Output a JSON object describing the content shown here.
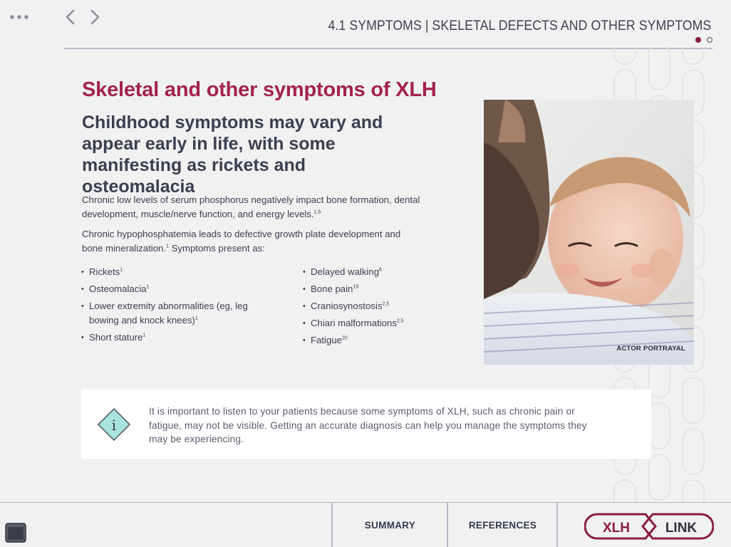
{
  "header": {
    "section_title": "4.1 SYMPTOMS | SKELETAL DEFECTS AND OTHER SYMPTOMS",
    "page_indicator": {
      "current": 1,
      "total": 2
    },
    "icons": {
      "more": "more-dots-icon",
      "back": "chevron-left-icon",
      "forward": "chevron-right-icon"
    }
  },
  "main": {
    "heading": "Skeletal and other symptoms of XLH",
    "subheading": "Childhood symptoms may vary and appear early in life, with some manifesting as rickets and osteomalacia",
    "paragraph1": {
      "text": "Chronic low levels of serum phosphorus negatively impact bone formation, dental development, muscle/nerve function, and energy levels.",
      "ref": "1,5"
    },
    "paragraph2": {
      "text": "Chronic hypophosphatemia leads to defective growth plate development and bone mineralization.",
      "ref": "1",
      "tail": " Symptoms present as:"
    },
    "symptoms_left": [
      {
        "label": "Rickets",
        "ref": "1"
      },
      {
        "label": "Osteomalacia",
        "ref": "1"
      },
      {
        "label": "Lower extremity abnormalities (eg, leg bowing and knock knees)",
        "ref": "1"
      },
      {
        "label": "Short stature",
        "ref": "1"
      }
    ],
    "symptoms_right": [
      {
        "label": "Delayed walking",
        "ref": "6"
      },
      {
        "label": "Bone pain",
        "ref": "19"
      },
      {
        "label": "Craniosynostosis",
        "ref": "2,5"
      },
      {
        "label": "Chiari malformations",
        "ref": "2,5"
      },
      {
        "label": "Fatigue",
        "ref": "20"
      }
    ],
    "photo_caption": "ACTOR PORTRAYAL"
  },
  "info_box": {
    "icon": "info-diamond-icon",
    "icon_glyph": "i",
    "text": "It is important to listen to your patients because some symptoms of XLH, such as chronic pain or fatigue, may not be visible. Getting an accurate diagnosis can help you manage the symptoms they may be experiencing."
  },
  "footer": {
    "summary_label": "SUMMARY",
    "references_label": "REFERENCES",
    "logo": {
      "left": "XLH",
      "right": "LINK"
    }
  },
  "colors": {
    "accent": "#a3234b",
    "logo": "#8a1e3c",
    "text": "#3b3f4f",
    "info_fill": "#a9e3dd",
    "background": "#f1f1f2"
  }
}
